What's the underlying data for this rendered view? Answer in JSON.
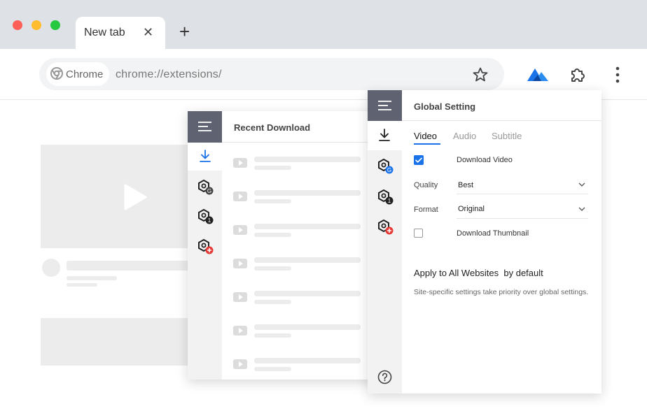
{
  "browser": {
    "tab_title": "New tab",
    "tab_close": "✕",
    "new_tab": "+",
    "chip_label": "Chrome",
    "url": "chrome://extensions/",
    "colors": {
      "close": "#fe5f57",
      "minimize": "#febc2e",
      "maximize": "#28c840",
      "accent": "#1a73e8"
    }
  },
  "recent_panel": {
    "title": "Recent Download",
    "rail_icons": [
      "download-icon",
      "hex-g-icon",
      "hex-1-icon",
      "hex-plus-icon"
    ],
    "items": [
      {},
      {},
      {},
      {},
      {},
      {},
      {}
    ]
  },
  "settings_panel": {
    "title": "Global Setting",
    "tabs": [
      "Video",
      "Audio",
      "Subtitle"
    ],
    "active_tab": "Video",
    "download_video": {
      "label": "Download Video",
      "checked": true
    },
    "quality": {
      "label": "Quality",
      "value": "Best"
    },
    "format": {
      "label": "Format",
      "value": "Original"
    },
    "download_thumbnail": {
      "label": "Download Thumbnail",
      "checked": false
    },
    "apply_label": "Apply to All Websites  by default",
    "apply_note": "Site-specific settings take priority over global settings."
  }
}
